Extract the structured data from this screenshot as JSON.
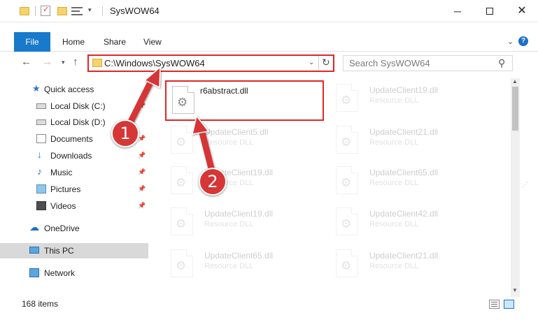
{
  "window": {
    "title": "SysWOW64"
  },
  "ribbon": {
    "tabs": [
      "File",
      "Home",
      "Share",
      "View"
    ]
  },
  "address": {
    "path": "C:\\Windows\\SysWOW64"
  },
  "search": {
    "placeholder": "Search SysWOW64"
  },
  "sidebar": {
    "items": [
      {
        "label": "Quick access",
        "icon": "star-icon"
      },
      {
        "label": "Local Disk (C:)",
        "icon": "disk-icon"
      },
      {
        "label": "Local Disk (D:)",
        "icon": "disk-icon"
      },
      {
        "label": "Documents",
        "icon": "documents-icon"
      },
      {
        "label": "Downloads",
        "icon": "download-icon"
      },
      {
        "label": "Music",
        "icon": "music-icon"
      },
      {
        "label": "Pictures",
        "icon": "pictures-icon"
      },
      {
        "label": "Videos",
        "icon": "video-icon"
      },
      {
        "label": "OneDrive",
        "icon": "cloud-icon"
      },
      {
        "label": "This PC",
        "icon": "computer-icon"
      },
      {
        "label": "Network",
        "icon": "network-icon"
      }
    ]
  },
  "files": {
    "highlighted": {
      "name": "r6abstract.dll",
      "type": ""
    },
    "left_column": [
      {
        "name": "UpdateClient5.dll",
        "type": "Resource DLL"
      },
      {
        "name": "UpdateClient19.dll",
        "type": "Resource DLL"
      },
      {
        "name": "UpdateClient19.dll",
        "type": "Resource DLL"
      },
      {
        "name": "UpdateClient65.dll",
        "type": "Resource DLL"
      }
    ],
    "right_column": [
      {
        "name": "UpdateClient19.dll",
        "type": "Resource DLL"
      },
      {
        "name": "UpdateClient21.dll",
        "type": "Resource DLL"
      },
      {
        "name": "UpdateClient65.dll",
        "type": "Resource DLL"
      },
      {
        "name": "UpdateClient42.dll",
        "type": "Resource DLL"
      },
      {
        "name": "UpdateClient21.dll",
        "type": "Resource DLL"
      }
    ]
  },
  "status": {
    "item_count": "168 items"
  },
  "annotations": {
    "step1": "1",
    "step2": "2",
    "color": "#d63636"
  }
}
